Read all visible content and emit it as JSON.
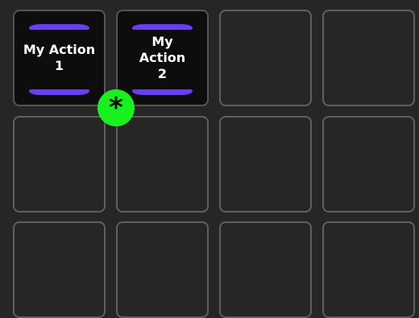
{
  "keys": [
    {
      "label": "My Action 1",
      "type": "action"
    },
    {
      "label": "My\nAction\n2",
      "type": "action"
    },
    {
      "label": "",
      "type": "empty"
    },
    {
      "label": "",
      "type": "empty"
    },
    {
      "label": "",
      "type": "empty"
    },
    {
      "label": "",
      "type": "empty"
    },
    {
      "label": "",
      "type": "empty"
    },
    {
      "label": "",
      "type": "empty"
    },
    {
      "label": "",
      "type": "empty"
    },
    {
      "label": "",
      "type": "empty"
    },
    {
      "label": "",
      "type": "empty"
    },
    {
      "label": "",
      "type": "empty"
    }
  ],
  "badge": {
    "symbol": "*",
    "color": "#18f020"
  },
  "colors": {
    "accent": "#6a3ef0",
    "background": "#262626",
    "key_border": "#5f5f5f"
  }
}
